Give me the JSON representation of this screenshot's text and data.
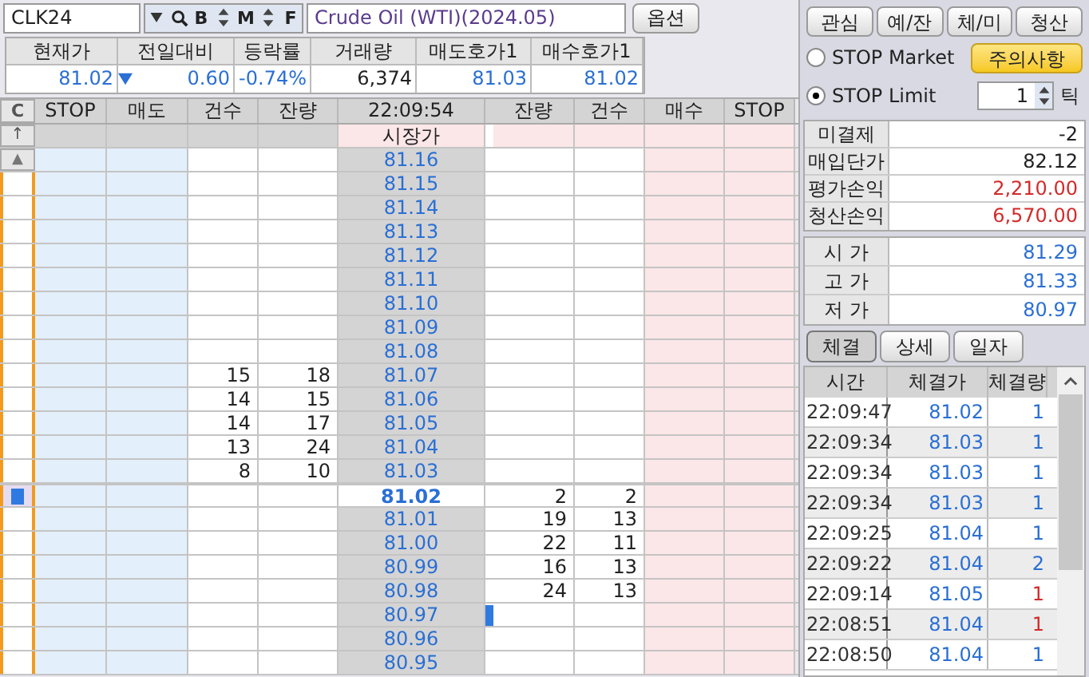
{
  "symbol": {
    "code": "CLK24",
    "name": "Crude Oil (WTI)(2024.05)",
    "tool_buttons": [
      "B",
      "M",
      "F"
    ]
  },
  "option_button": "옵션",
  "quote": {
    "columns": [
      "현재가",
      "전일대비",
      "등락률",
      "거래량",
      "매도호가1",
      "매수호가1"
    ],
    "values": [
      "81.02",
      "0.60",
      "-0.74%",
      "6,374",
      "81.03",
      "81.02"
    ],
    "falling": true
  },
  "order_book": {
    "clear_button": "C",
    "top_button": "↑",
    "up_button": "▲",
    "columns": [
      "STOP",
      "매도",
      "건수",
      "잔량",
      "22:09:54",
      "잔량",
      "건수",
      "매수",
      "STOP"
    ],
    "rows": [
      {
        "kind": "market",
        "price": "시장가"
      },
      {
        "kind": "price",
        "price": "81.16",
        "current": false,
        "marked": false
      },
      {
        "kind": "price",
        "price": "81.15",
        "current": false,
        "marked": false
      },
      {
        "kind": "price",
        "price": "81.14",
        "current": false,
        "marked": false
      },
      {
        "kind": "price",
        "price": "81.13",
        "current": false,
        "marked": false
      },
      {
        "kind": "price",
        "price": "81.12",
        "current": false,
        "marked": false
      },
      {
        "kind": "price",
        "price": "81.11",
        "current": false,
        "marked": false
      },
      {
        "kind": "price",
        "price": "81.10",
        "current": false,
        "marked": false
      },
      {
        "kind": "price",
        "price": "81.09",
        "current": false,
        "marked": false
      },
      {
        "kind": "price",
        "price": "81.08",
        "current": false,
        "marked": false
      },
      {
        "kind": "price",
        "sell_count": "15",
        "sell_qty": "18",
        "price": "81.07",
        "current": false,
        "marked": false
      },
      {
        "kind": "price",
        "sell_count": "14",
        "sell_qty": "15",
        "price": "81.06",
        "current": false,
        "marked": false
      },
      {
        "kind": "price",
        "sell_count": "14",
        "sell_qty": "17",
        "price": "81.05",
        "current": false,
        "marked": false
      },
      {
        "kind": "price",
        "sell_count": "13",
        "sell_qty": "24",
        "price": "81.04",
        "current": false,
        "marked": false
      },
      {
        "kind": "price",
        "sell_count": "8",
        "sell_qty": "10",
        "price": "81.03",
        "current": false,
        "marked": false
      },
      {
        "kind": "price",
        "price": "81.02",
        "buy_qty": "2",
        "buy_count": "2",
        "current": true,
        "marked": false
      },
      {
        "kind": "price",
        "price": "81.01",
        "buy_qty": "19",
        "buy_count": "13",
        "current": false,
        "marked": false
      },
      {
        "kind": "price",
        "price": "81.00",
        "buy_qty": "22",
        "buy_count": "11",
        "current": false,
        "marked": false
      },
      {
        "kind": "price",
        "price": "80.99",
        "buy_qty": "16",
        "buy_count": "13",
        "current": false,
        "marked": false
      },
      {
        "kind": "price",
        "price": "80.98",
        "buy_qty": "24",
        "buy_count": "13",
        "current": false,
        "marked": false
      },
      {
        "kind": "price",
        "price": "80.97",
        "current": false,
        "marked": true
      },
      {
        "kind": "price",
        "price": "80.96",
        "current": false,
        "marked": false
      },
      {
        "kind": "price",
        "price": "80.95",
        "current": false,
        "marked": false
      }
    ]
  },
  "side_tabs": [
    "관심",
    "예/잔",
    "체/미",
    "청산"
  ],
  "stop_options": [
    {
      "label": "STOP Market",
      "selected": false
    },
    {
      "label": "STOP Limit",
      "selected": true
    }
  ],
  "caution_button": "주의사항",
  "tick": {
    "value": "1",
    "unit": "틱"
  },
  "position": [
    {
      "label": "미결제",
      "value": "-2",
      "color": "#222222"
    },
    {
      "label": "매입단가",
      "value": "82.12",
      "color": "#222222"
    },
    {
      "label": "평가손익",
      "value": "2,210.00",
      "color": "#d42a2a"
    },
    {
      "label": "청산손익",
      "value": "6,570.00",
      "color": "#d42a2a"
    }
  ],
  "prices": [
    {
      "label": "시 가",
      "value": "81.29"
    },
    {
      "label": "고 가",
      "value": "81.33"
    },
    {
      "label": "저 가",
      "value": "80.97"
    }
  ],
  "trade_tabs": [
    {
      "label": "체결",
      "selected": true
    },
    {
      "label": "상세",
      "selected": false
    },
    {
      "label": "일자",
      "selected": false
    }
  ],
  "trades": {
    "columns": [
      "시간",
      "체결가",
      "체결량"
    ],
    "rows": [
      {
        "time": "22:09:47",
        "price": "81.02",
        "qty": "1",
        "color": "#2a6fd4"
      },
      {
        "time": "22:09:34",
        "price": "81.03",
        "qty": "1",
        "color": "#2a6fd4"
      },
      {
        "time": "22:09:34",
        "price": "81.03",
        "qty": "1",
        "color": "#2a6fd4"
      },
      {
        "time": "22:09:34",
        "price": "81.03",
        "qty": "1",
        "color": "#2a6fd4"
      },
      {
        "time": "22:09:25",
        "price": "81.04",
        "qty": "1",
        "color": "#2a6fd4"
      },
      {
        "time": "22:09:22",
        "price": "81.04",
        "qty": "2",
        "color": "#2a6fd4"
      },
      {
        "time": "22:09:14",
        "price": "81.05",
        "qty": "1",
        "color": "#d42a2a"
      },
      {
        "time": "22:08:51",
        "price": "81.04",
        "qty": "1",
        "color": "#d42a2a"
      },
      {
        "time": "22:08:50",
        "price": "81.04",
        "qty": "1",
        "color": "#2a6fd4"
      }
    ]
  }
}
